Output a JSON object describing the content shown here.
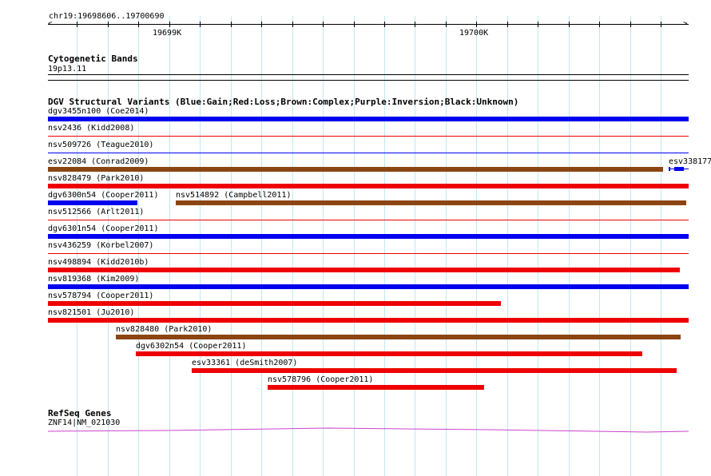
{
  "location": "chr19:19698606..19700690",
  "ruler": {
    "ticks": [
      {
        "label": "19699K",
        "pos": 19699000
      },
      {
        "label": "19700K",
        "pos": 19700000
      }
    ],
    "start": 19698606,
    "end": 19700690
  },
  "tracks": {
    "cytoband": {
      "title": "Cytogenetic Bands",
      "band": "19p13.11"
    },
    "dgv": {
      "title": "DGV Structural Variants (Blue:Gain;Red:Loss;Brown:Complex;Purple:Inversion;Black:Unknown)",
      "colors": {
        "gain": "#0000ee",
        "loss": "#ee0000",
        "complex": "#8b4513"
      },
      "features": [
        {
          "name": "dgv3455n100 (Coe2014)",
          "type": "gain",
          "row": 0,
          "start": 19698606,
          "end": 19700690,
          "thin": false
        },
        {
          "name": "nsv2436 (Kidd2008)",
          "type": "loss",
          "row": 1,
          "start": 19698606,
          "end": 19700690,
          "thin": true
        },
        {
          "name": "nsv509726 (Teague2010)",
          "type": "gain",
          "row": 2,
          "start": 19698606,
          "end": 19700690,
          "thin": true
        },
        {
          "name": "esv22084 (Conrad2009)",
          "type": "complex",
          "row": 3,
          "start": 19698606,
          "end": 19700606,
          "thin": false
        },
        {
          "name": "esv338177",
          "type": "gain",
          "row": 3,
          "start": 19700624,
          "end": 19700690,
          "thin": false,
          "gene_like": true
        },
        {
          "name": "nsv828479 (Park2010)",
          "type": "loss",
          "row": 4,
          "start": 19698606,
          "end": 19700690,
          "thin": false
        },
        {
          "name": "dgv6300n54 (Cooper2011)",
          "type": "gain",
          "row": 5,
          "start": 19698606,
          "end": 19698896,
          "thin": false
        },
        {
          "name": "nsv514892 (Campbell2011)",
          "type": "complex",
          "row": 5,
          "start": 19699022,
          "end": 19700681,
          "thin": false
        },
        {
          "name": "nsv512566 (Arlt2011)",
          "type": "loss",
          "row": 6,
          "start": 19698606,
          "end": 19700690,
          "thin": true
        },
        {
          "name": "dgv6301n54 (Cooper2011)",
          "type": "gain",
          "row": 7,
          "start": 19698606,
          "end": 19700690,
          "thin": false
        },
        {
          "name": "nsv436259 (Korbel2007)",
          "type": "loss",
          "row": 8,
          "start": 19698606,
          "end": 19700690,
          "thin": true
        },
        {
          "name": "nsv498894 (Kidd2010b)",
          "type": "loss",
          "row": 9,
          "start": 19698606,
          "end": 19700662,
          "thin": false
        },
        {
          "name": "nsv819368 (Kim2009)",
          "type": "gain",
          "row": 10,
          "start": 19698606,
          "end": 19700690,
          "thin": false
        },
        {
          "name": "nsv578794 (Cooper2011)",
          "type": "loss",
          "row": 11,
          "start": 19698606,
          "end": 19700079,
          "thin": false
        },
        {
          "name": "nsv821501 (Ju2010)",
          "type": "loss",
          "row": 12,
          "start": 19698606,
          "end": 19700690,
          "thin": false
        },
        {
          "name": "nsv828480 (Park2010)",
          "type": "complex",
          "row": 13,
          "start": 19698826,
          "end": 19700664,
          "thin": false
        },
        {
          "name": "dgv6302n54 (Cooper2011)",
          "type": "loss",
          "row": 14,
          "start": 19698893,
          "end": 19700539,
          "thin": false
        },
        {
          "name": "esv33361 (deSmith2007)",
          "type": "loss",
          "row": 15,
          "start": 19699074,
          "end": 19700651,
          "thin": false
        },
        {
          "name": "nsv578796 (Cooper2011)",
          "type": "loss",
          "row": 16,
          "start": 19699321,
          "end": 19700024,
          "thin": false
        }
      ]
    },
    "refseq": {
      "title": "RefSeq Genes",
      "gene": "ZNF14|NM_021030",
      "color": "#cc44cc"
    }
  }
}
